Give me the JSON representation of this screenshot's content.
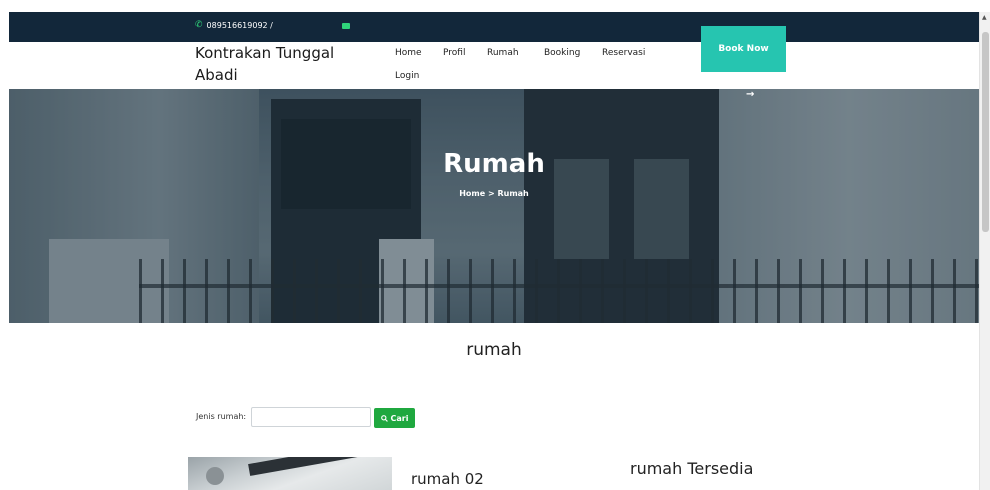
{
  "topbar": {
    "phone_icon": "phone-icon",
    "phone": "089516619092 /",
    "mail_icon": "envelope-icon"
  },
  "navbar": {
    "brand_line1": "Kontrakan Tunggal",
    "brand_line2": "Abadi",
    "items": [
      "Home",
      "Profil",
      "Rumah",
      "Booking",
      "Reservasi",
      "Login"
    ],
    "book_now": "Book Now"
  },
  "hero": {
    "arrow": "→",
    "title": "Rumah",
    "breadcrumb": "Home > Rumah"
  },
  "section": {
    "title": "rumah"
  },
  "search": {
    "label": "Jenis rumah:",
    "value": "",
    "button": "Cari",
    "button_icon": "search-icon"
  },
  "listing": {
    "card_title": "rumah 02",
    "available_title": "rumah Tersedia"
  },
  "colors": {
    "topbar": "#12273a",
    "accent": "#26c5b0",
    "search_button": "#1fa83f"
  }
}
